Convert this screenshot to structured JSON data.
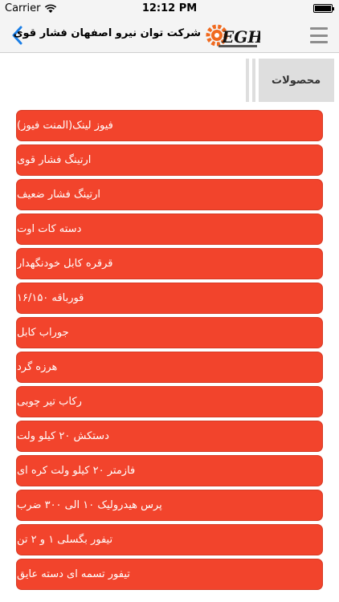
{
  "status_bar": {
    "carrier": "Carrier",
    "time": "12:12 PM",
    "battery_level": 1.0
  },
  "nav": {
    "title": "شرکت توان نیرو اصفهان فشار قوی",
    "logo_text": "EGH",
    "back_icon": "chevron-left-icon",
    "menu_icon": "hamburger-menu-icon",
    "accent_color": "#1a7ee6"
  },
  "section": {
    "title": "محصولات"
  },
  "products": [
    {
      "label": "فیوز لینک(المنت فیوز)"
    },
    {
      "label": "ارتینگ فشار قوی"
    },
    {
      "label": "ارتینگ فشار ضعیف"
    },
    {
      "label": "دسته کات اوت"
    },
    {
      "label": "قرقره کابل خودنگهدار"
    },
    {
      "label": "قورباقه ۱۶/۱۵۰"
    },
    {
      "label": "جوراب کابل"
    },
    {
      "label": "هرزه گرد"
    },
    {
      "label": "رکاب تیر چوبی"
    },
    {
      "label": "دستکش ۲۰ کیلو ولت"
    },
    {
      "label": "فازمتر ۲۰ کیلو ولت کره ای"
    },
    {
      "label": "پرس هیدرولیک ۱۰ الی ۳۰۰ ضرب"
    },
    {
      "label": "تیفور بگسلی ۱ و ۲ تن"
    },
    {
      "label": "تیفور تسمه ای دسته عایق"
    }
  ],
  "colors": {
    "button_red": "#f2442c",
    "logo_orange": "#f06a1f"
  }
}
